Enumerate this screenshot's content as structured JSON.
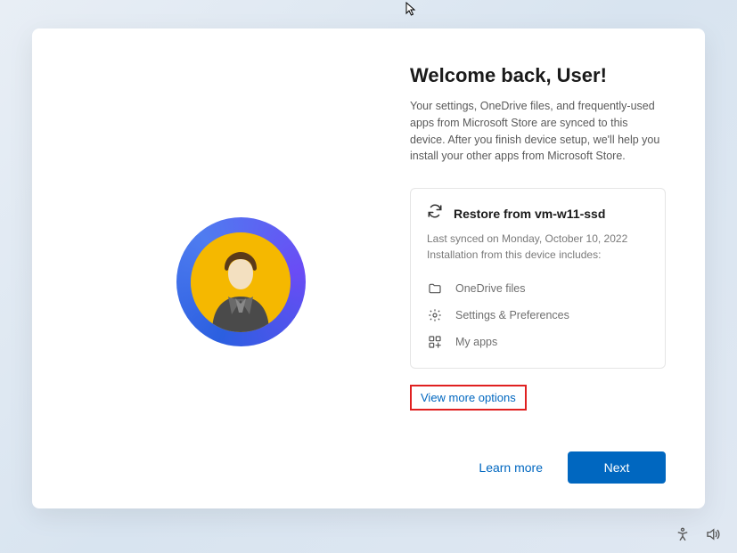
{
  "header": {
    "title": "Welcome back, User!",
    "subtitle": "Your settings, OneDrive files, and frequently-used apps from Microsoft Store are synced to this device. After you finish device setup, we'll help you install your other apps from Microsoft Store."
  },
  "restore": {
    "title": "Restore from vm-w11-ssd",
    "last_synced": "Last synced on Monday, October 10, 2022",
    "includes_label": "Installation from this device includes:",
    "items": [
      {
        "icon": "folder-icon",
        "label": "OneDrive files"
      },
      {
        "icon": "gear-icon",
        "label": "Settings & Preferences"
      },
      {
        "icon": "apps-icon",
        "label": "My apps"
      }
    ]
  },
  "links": {
    "view_more": "View more options",
    "learn_more": "Learn more"
  },
  "buttons": {
    "next": "Next"
  }
}
